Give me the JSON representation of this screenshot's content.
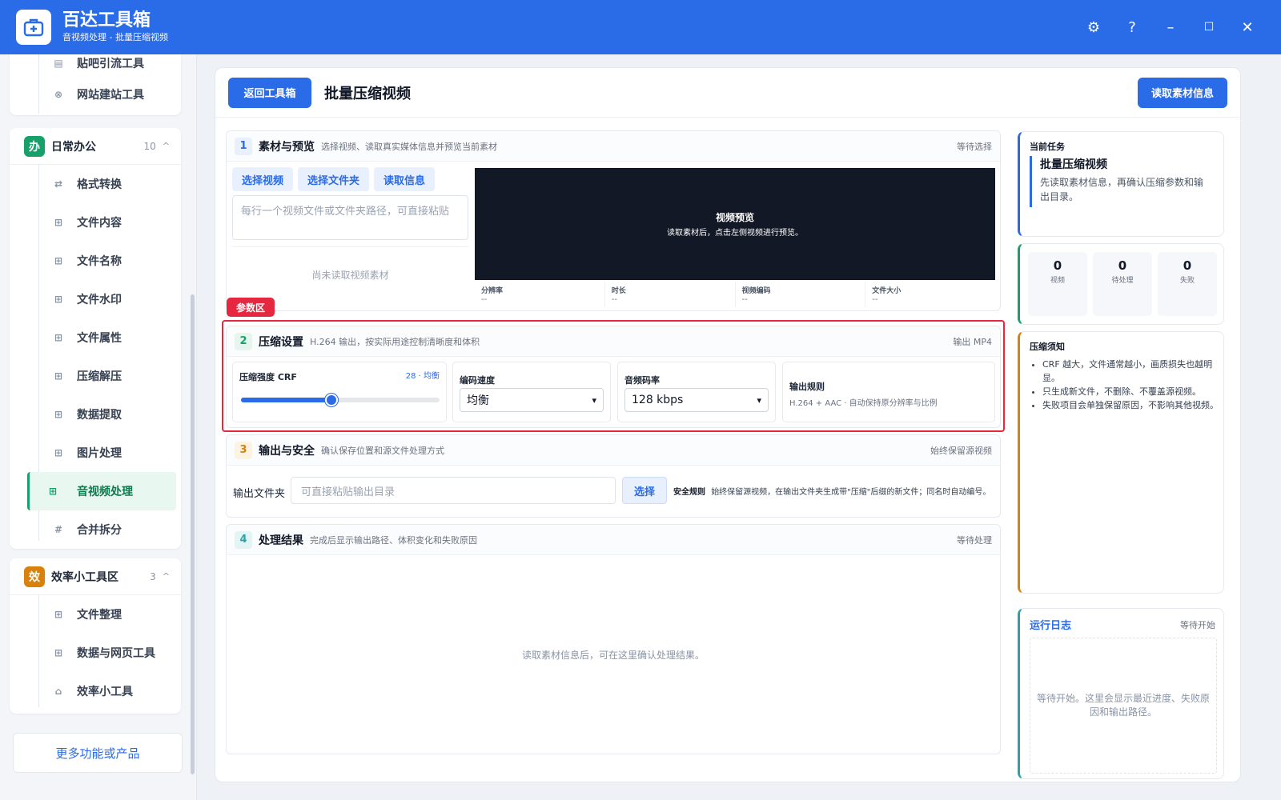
{
  "app": {
    "title": "百达工具箱",
    "subtitle": "音视频处理 - 批量压缩视频"
  },
  "window_controls": {
    "settings": "⚙",
    "help": "?",
    "minimize": "–",
    "maximize": "☐",
    "close": "✕"
  },
  "sidebar": {
    "top_items": [
      {
        "label": "贴吧引流工具",
        "icon": "doc-icon"
      },
      {
        "label": "网站建站工具",
        "icon": "globe-icon"
      }
    ],
    "group_office": {
      "badge": "办",
      "name": "日常办公",
      "count": "10",
      "caret": "^",
      "color": "#16a06a",
      "items": [
        {
          "label": "格式转换",
          "icon": "⇄"
        },
        {
          "label": "文件内容",
          "icon": "⊞"
        },
        {
          "label": "文件名称",
          "icon": "⊞"
        },
        {
          "label": "文件水印",
          "icon": "⊞"
        },
        {
          "label": "文件属性",
          "icon": "⊞"
        },
        {
          "label": "压缩解压",
          "icon": "⊞"
        },
        {
          "label": "数据提取",
          "icon": "⊞"
        },
        {
          "label": "图片处理",
          "icon": "⊞"
        },
        {
          "label": "音视频处理",
          "icon": "⊞"
        },
        {
          "label": "合并拆分",
          "icon": "#"
        }
      ]
    },
    "group_efficiency": {
      "badge": "效",
      "name": "效率小工具区",
      "count": "3",
      "caret": "^",
      "color": "#d9820b",
      "items": [
        {
          "label": "文件整理",
          "icon": "⊞"
        },
        {
          "label": "数据与网页工具",
          "icon": "⊞"
        },
        {
          "label": "效率小工具",
          "icon": "⌂"
        }
      ]
    },
    "more_label": "更多功能或产品"
  },
  "main": {
    "back_label": "返回工具箱",
    "title": "批量压缩视频",
    "read_info_label": "读取素材信息",
    "section1": {
      "num": "1",
      "title": "素材与预览",
      "desc": "选择视频、读取真实媒体信息并预览当前素材",
      "status": "等待选择",
      "btn_select_video": "选择视频",
      "btn_select_folder": "选择文件夹",
      "btn_read_info": "读取信息",
      "textarea_placeholder": "每行一个视频文件或文件夹路径，可直接粘贴",
      "empty_text": "尚未读取视频素材",
      "preview_title": "视频预览",
      "preview_hint": "读取素材后，点击左侧视频进行预览。",
      "meta": [
        {
          "label": "分辨率",
          "value": "--"
        },
        {
          "label": "时长",
          "value": "--"
        },
        {
          "label": "视频编码",
          "value": "--"
        },
        {
          "label": "文件大小",
          "value": "--"
        }
      ]
    },
    "param_tag": "参数区",
    "section2": {
      "num": "2",
      "title": "压缩设置",
      "desc": "H.264 输出，按实际用途控制清晰度和体积",
      "status": "输出 MP4",
      "crf_label": "压缩强度 CRF",
      "crf_value_text": "28 · 均衡",
      "crf_value": 28,
      "crf_min": 18,
      "crf_max": 40,
      "speed_label": "编码速度",
      "speed_value": "均衡",
      "audio_label": "音频码率",
      "audio_value": "128 kbps",
      "rule_label": "输出规则",
      "rule_text": "H.264 + AAC · 自动保持原分辨率与比例"
    },
    "section3": {
      "num": "3",
      "title": "输出与安全",
      "desc": "确认保存位置和源文件处理方式",
      "status": "始终保留源视频",
      "folder_label": "输出文件夹",
      "folder_placeholder": "可直接粘贴输出目录",
      "choose_label": "选择",
      "safety_label": "安全规则",
      "safety_text": "始终保留源视频，在输出文件夹生成带\"压缩\"后缀的新文件；同名时自动编号。"
    },
    "section4": {
      "num": "4",
      "title": "处理结果",
      "desc": "完成后显示输出路径、体积变化和失败原因",
      "status": "等待处理",
      "empty_text": "读取素材信息后，可在这里确认处理结果。"
    }
  },
  "right": {
    "task_label": "当前任务",
    "task_title": "批量压缩视频",
    "task_desc": "先读取素材信息，再确认压缩参数和输出目录。",
    "stats": [
      {
        "num": "0",
        "label": "视频"
      },
      {
        "num": "0",
        "label": "待处理"
      },
      {
        "num": "0",
        "label": "失败"
      }
    ],
    "notice_title": "压缩须知",
    "notices": [
      "CRF 越大，文件通常越小，画质损失也越明显。",
      "只生成新文件，不删除、不覆盖源视频。",
      "失败项目会单独保留原因，不影响其他视频。"
    ],
    "log_title": "运行日志",
    "log_status": "等待开始",
    "log_text": "等待开始。这里会显示最近进度、失败原因和输出路径。"
  },
  "colors": {
    "primary": "#2a6be8",
    "accent_red": "#e5283f",
    "green": "#16a06a",
    "orange": "#d9820b",
    "teal": "#2aa3a8"
  }
}
